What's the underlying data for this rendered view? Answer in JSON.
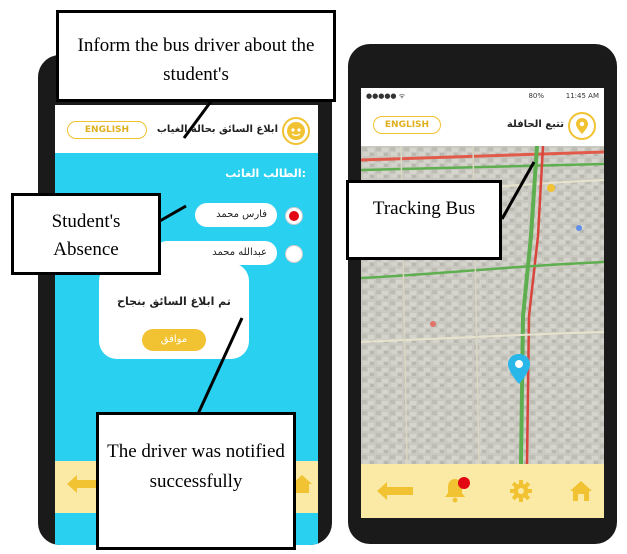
{
  "left_screen": {
    "language_button": "ENGLISH",
    "title": "ابلاغ السائق بحالة الغياب",
    "section_label": "الطالب الغائب:",
    "students": [
      {
        "name": "فارس محمد",
        "selected": true
      },
      {
        "name": "عبدالله محمد",
        "selected": false
      }
    ],
    "dialog": {
      "message": "تم ابلاغ السائق بنجاح",
      "ok_button": "موافق"
    }
  },
  "right_screen": {
    "status_bar": {
      "signal": "●●●●● ᯤ",
      "battery": "80%",
      "time": "11:45 AM"
    },
    "language_button": "ENGLISH",
    "title": "تتبع الحافلة",
    "nav": [
      "back-arrow-icon",
      "bell-icon",
      "gear-icon",
      "home-icon"
    ]
  },
  "callouts": {
    "inform_driver": "Inform the bus driver about the student's",
    "student_absence": "Student's Absence",
    "tracking_bus": "Tracking Bus",
    "driver_notified": "The driver was notified successfully"
  },
  "colors": {
    "accent": "#f1c232",
    "screen_bg": "#29d0ef",
    "selected_radio": "#e30613",
    "nav_bar": "#fbe9a6"
  }
}
